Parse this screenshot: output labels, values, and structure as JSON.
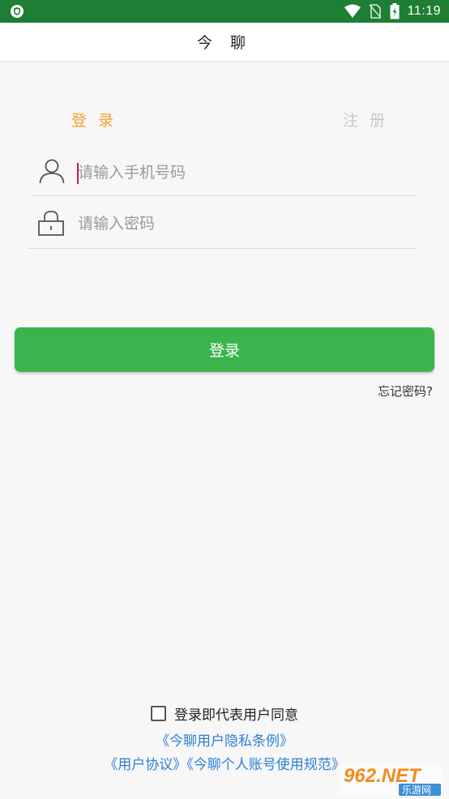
{
  "status_bar": {
    "time": "11:19",
    "icons": [
      "shield-icon",
      "wifi-icon",
      "no-sim-icon",
      "battery-charging-icon"
    ]
  },
  "app_bar": {
    "title": "今 聊"
  },
  "tabs": {
    "login": "登 录",
    "register": "注 册"
  },
  "form": {
    "phone": {
      "placeholder": "请输入手机号码",
      "value": "",
      "icon": "user-icon"
    },
    "password": {
      "placeholder": "请输入密码",
      "value": "",
      "icon": "lock-icon"
    }
  },
  "actions": {
    "login_button": "登录",
    "forgot_password": "忘记密码?"
  },
  "agreement": {
    "checked": false,
    "text": "登录即代表用户同意",
    "privacy_policy": "《今聊用户隐私条例》",
    "user_agreement": "《用户协议》",
    "account_rules": "《今聊个人账号使用规范》"
  },
  "watermark": {
    "text": "962.NET",
    "subtext": "乐游网"
  },
  "colors": {
    "status_bar": "#1e7e34",
    "accent_tab": "#f0a033",
    "inactive_tab": "#c9c9c9",
    "button": "#3cb44e",
    "link": "#2b7fd6"
  }
}
